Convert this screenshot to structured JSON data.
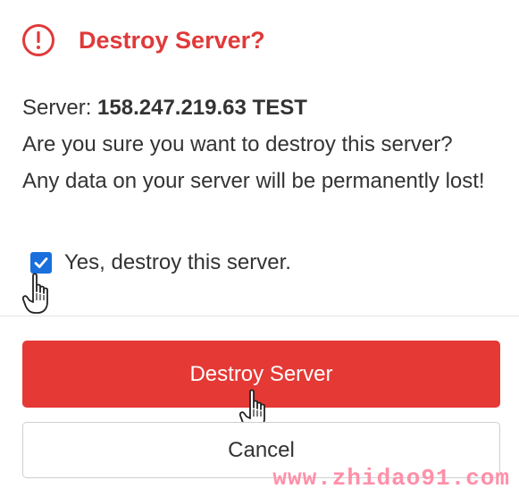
{
  "dialog": {
    "title": "Destroy Server?",
    "server_label": "Server: ",
    "server_value": "158.247.219.63 TEST",
    "message": "Are you sure you want to destroy this server? Any data on your server will be permanently lost!",
    "confirm_checkbox_label": "Yes, destroy this server.",
    "confirm_checked": true,
    "destroy_button_label": "Destroy Server",
    "cancel_button_label": "Cancel"
  },
  "icons": {
    "warning": "alert-circle-icon",
    "cursor": "hand-pointer-icon",
    "check": "checkmark-icon"
  },
  "colors": {
    "danger": "#e53935",
    "title": "#e03a3a",
    "checkbox": "#1a6fdc",
    "text": "#333333",
    "watermark": "#ff8fa8"
  },
  "watermark": "www.zhidao91.com"
}
